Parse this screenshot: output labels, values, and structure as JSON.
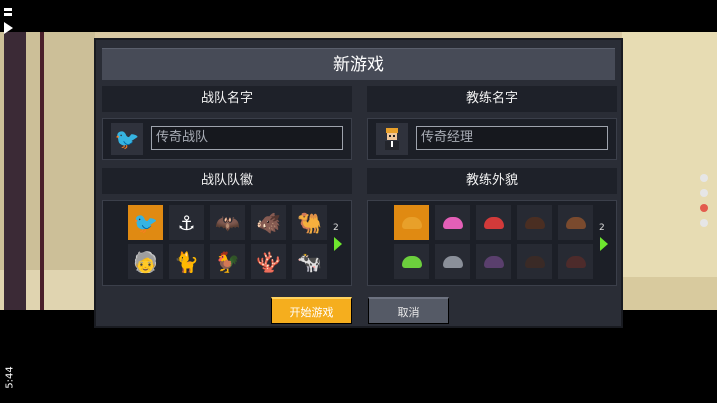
{
  "status": {
    "time": "5:44"
  },
  "dialog": {
    "title": "新游戏",
    "team_name": {
      "header": "战队名字",
      "placeholder": "传奇战队",
      "avatar_icon": "seagull-icon"
    },
    "coach_name": {
      "header": "教练名字",
      "placeholder": "传奇经理",
      "avatar_icon": "coach-avatar-icon"
    },
    "team_badge": {
      "header": "战队队徽",
      "page": "2",
      "icons": [
        {
          "name": "seagull-icon",
          "glyph": "🐦",
          "selected": true
        },
        {
          "name": "anchor-icon",
          "glyph": "⚓",
          "selected": false
        },
        {
          "name": "bat-icon",
          "glyph": "🦇",
          "selected": false
        },
        {
          "name": "boar-icon",
          "glyph": "🐗",
          "selected": false
        },
        {
          "name": "camel-icon",
          "glyph": "🐫",
          "selected": false
        },
        {
          "name": "old-man-icon",
          "glyph": "🧓",
          "selected": false
        },
        {
          "name": "cat-icon",
          "glyph": "🐈",
          "selected": false
        },
        {
          "name": "rooster-icon",
          "glyph": "🐓",
          "selected": false
        },
        {
          "name": "coral-icon",
          "glyph": "🪸",
          "selected": false
        },
        {
          "name": "cow-icon",
          "glyph": "🐄",
          "selected": false
        }
      ]
    },
    "coach_appearance": {
      "header": "教练外貌",
      "page": "2",
      "hairstyles": [
        {
          "name": "hair-orange-icon",
          "color": "#e8a02a",
          "selected": true
        },
        {
          "name": "hair-pink-icon",
          "color": "#e35fb7",
          "selected": false
        },
        {
          "name": "hair-red-icon",
          "color": "#d23a3a",
          "selected": false
        },
        {
          "name": "hair-dark-brown-icon",
          "color": "#4a2e22",
          "selected": false
        },
        {
          "name": "hair-brown-icon",
          "color": "#7a4a2e",
          "selected": false
        },
        {
          "name": "hair-green-icon",
          "color": "#6ccf3d",
          "selected": false
        },
        {
          "name": "hair-gray-icon",
          "color": "#8a8f99",
          "selected": false
        },
        {
          "name": "hair-purple-icon",
          "color": "#5a3f6d",
          "selected": false
        },
        {
          "name": "hair-black-icon",
          "color": "#3a2a26",
          "selected": false
        },
        {
          "name": "hair-maroon-icon",
          "color": "#4d2b2b",
          "selected": false
        }
      ]
    },
    "buttons": {
      "start": "开始游戏",
      "cancel": "取消"
    }
  },
  "colors": {
    "accent": "#f5ae1e",
    "selected": "#e08a12",
    "next_arrow": "#6ee62e",
    "active_dot": "#e35b4d"
  },
  "page_indicator": {
    "count": 4,
    "active_index": 2
  }
}
